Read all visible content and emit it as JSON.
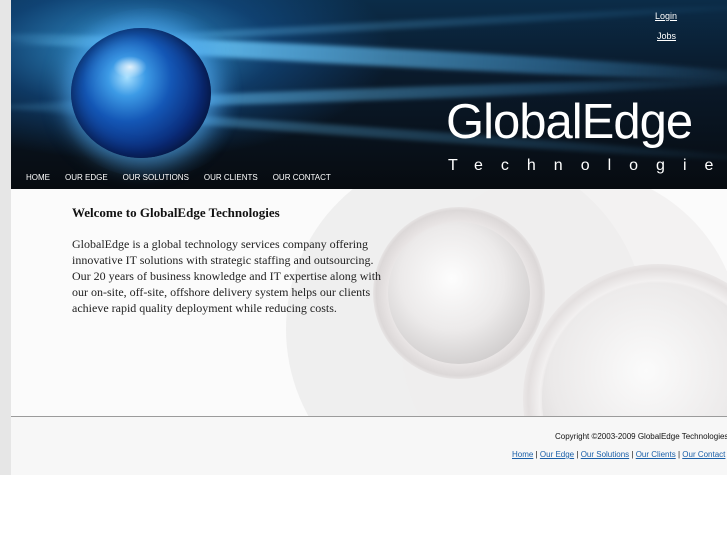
{
  "header": {
    "login_label": "Login",
    "jobs_label": "Jobs",
    "logo_main": "GlobalEdge",
    "logo_sub": "Technologies",
    "nav": [
      "HOME",
      "OUR EDGE",
      "OUR SOLUTIONS",
      "OUR CLIENTS",
      "OUR CONTACT"
    ]
  },
  "main": {
    "title": "Welcome to GlobalEdge Technologies",
    "body": "GlobalEdge is a global technology services company offering innovative IT solutions with strategic staffing and outsourcing. Our 20 years of business knowledge and IT expertise along with our on-site, off-site, offshore delivery system helps our clients achieve rapid quality deployment while reducing costs."
  },
  "footer": {
    "copyright": "Copyright ©2003-2009 GlobalEdge Technologies",
    "links": [
      "Home",
      "Our Edge",
      "Our Solutions",
      "Our Clients",
      "Our Contact"
    ],
    "separator": "|"
  },
  "colors": {
    "header_dark": "#070b10",
    "accent_blue": "#3d9be6",
    "footer_link": "#1a5fa8"
  },
  "icons": [
    "globe-orb-graphic",
    "silver-ring-graphic"
  ]
}
